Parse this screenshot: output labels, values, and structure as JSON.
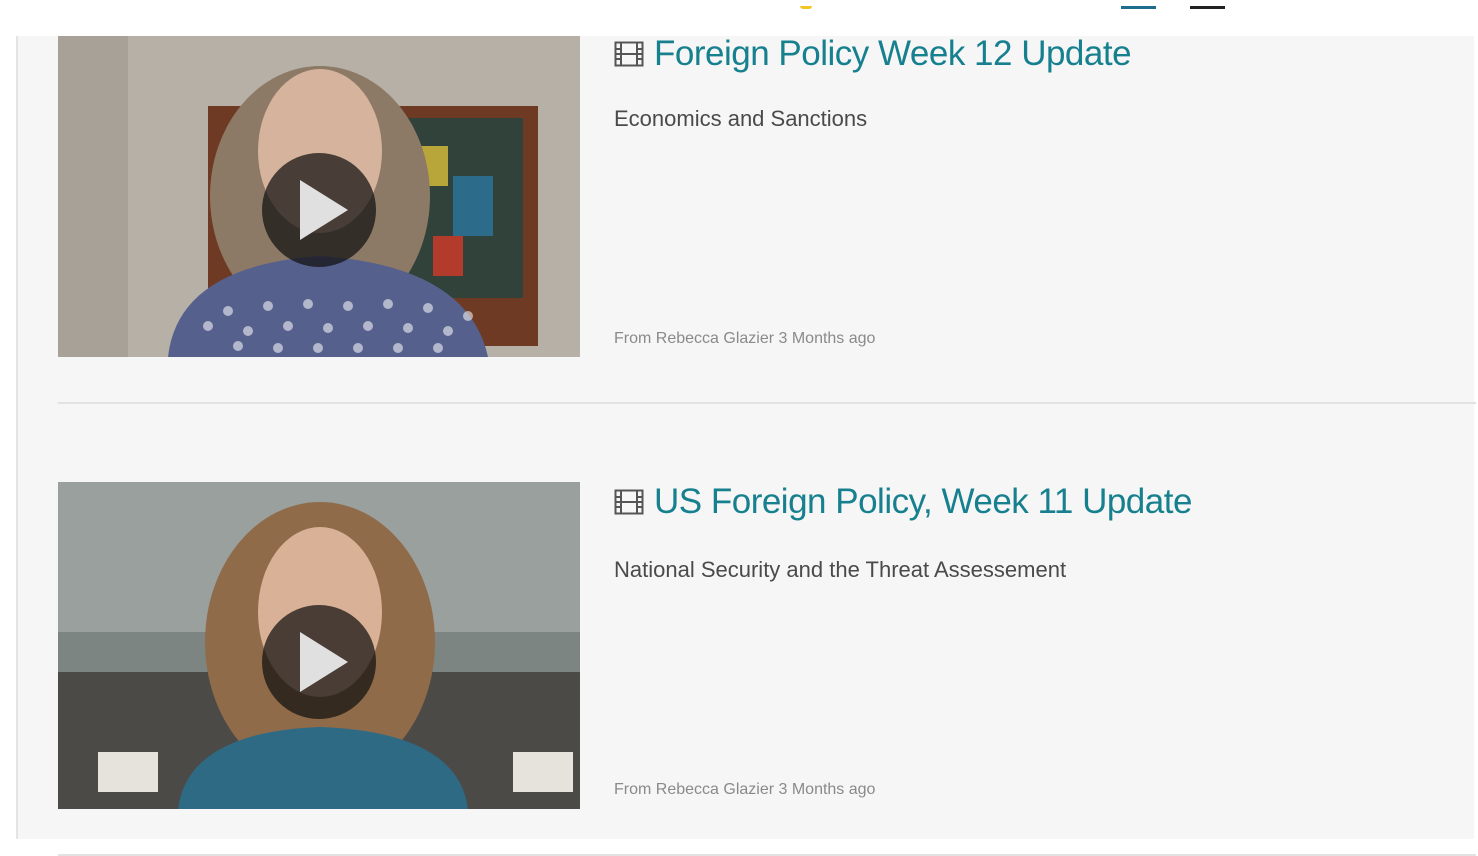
{
  "media_list": [
    {
      "icon": "film-icon",
      "title": "Foreign Policy Week 12 Update",
      "description": "Economics and Sanctions",
      "byline": "From Rebecca Glazier 3 Months ago"
    },
    {
      "icon": "film-icon",
      "title": "US Foreign Policy, Week 11 Update",
      "description": "National Security and the Threat Assessement",
      "byline": "From Rebecca Glazier 3 Months ago"
    }
  ],
  "colors": {
    "title": "#17808f",
    "background": "#f6f6f6",
    "text": "#4a4a4a",
    "meta": "#8a8a8a"
  }
}
